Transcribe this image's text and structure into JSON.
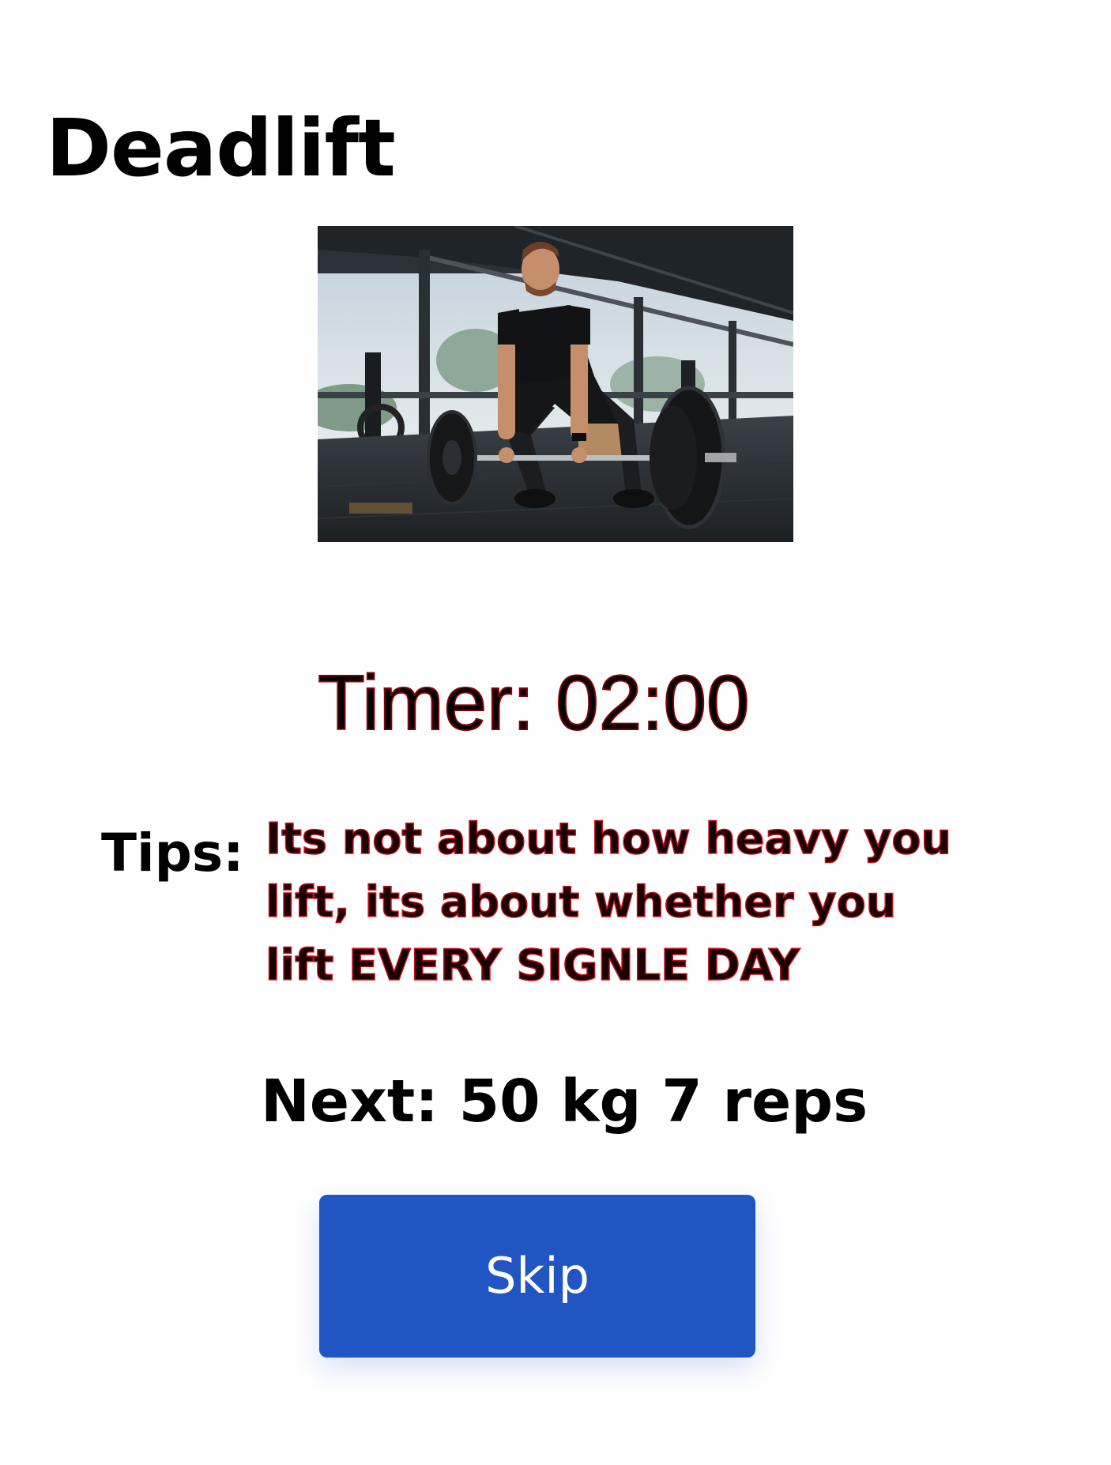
{
  "exercise": {
    "title": "Deadlift",
    "image_subject": "man-performing-deadlift-in-gym"
  },
  "timer": {
    "text": "Timer: 02:00"
  },
  "tips": {
    "label": "Tips:",
    "text": "Its not about how heavy you lift, its about whether you lift EVERY SIGNLE DAY"
  },
  "next_set": {
    "text": "Next: 50 kg 7 reps"
  },
  "actions": {
    "skip_label": "Skip"
  },
  "colors": {
    "button_primary": "#2155c4",
    "tip_outline": "#c4101a",
    "timer_outline": "#8b0000"
  }
}
